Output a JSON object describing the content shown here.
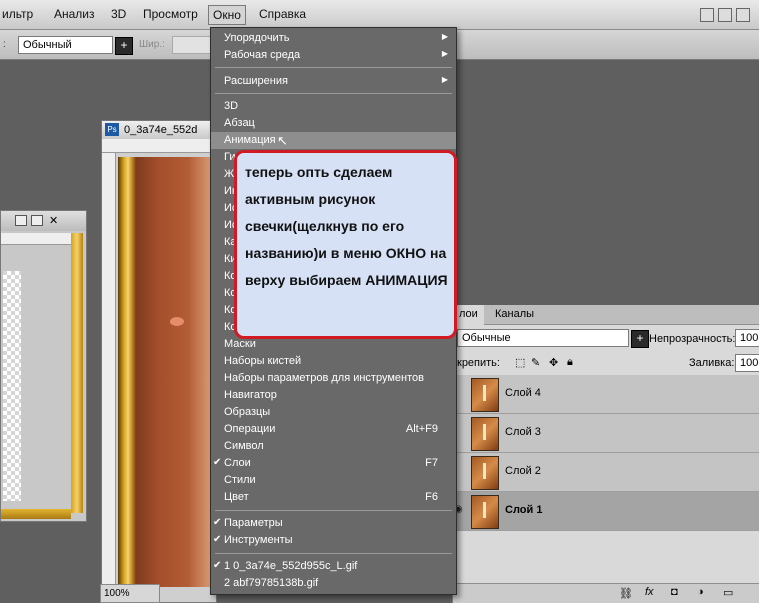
{
  "menubar": {
    "items": [
      "ильтр",
      "Анализ",
      "3D",
      "Просмотр",
      "Окно",
      "Справка"
    ],
    "active": "Окно"
  },
  "options": {
    "mode": "Обычный",
    "width_label": "Шир.:"
  },
  "window_menu": {
    "items": [
      {
        "label": "Упорядочить",
        "submenu": true
      },
      {
        "label": "Рабочая среда",
        "submenu": true
      },
      {
        "label": "Расширения",
        "submenu": true
      },
      {
        "label": "3D"
      },
      {
        "label": "Абзац"
      },
      {
        "label": "Анимация",
        "highlighted": true
      },
      {
        "label": "Ги"
      },
      {
        "label": "Ж"
      },
      {
        "label": "Ин"
      },
      {
        "label": "Ис"
      },
      {
        "label": "Ис"
      },
      {
        "label": "Ка"
      },
      {
        "label": "Ки"
      },
      {
        "label": "Ко"
      },
      {
        "label": "Ко"
      },
      {
        "label": "Ко"
      },
      {
        "label": "Ко"
      },
      {
        "label": "Маски"
      },
      {
        "label": "Наборы кистей"
      },
      {
        "label": "Наборы параметров для инструментов"
      },
      {
        "label": "Навигатор"
      },
      {
        "label": "Образцы"
      },
      {
        "label": "Операции",
        "shortcut": "Alt+F9"
      },
      {
        "label": "Символ"
      },
      {
        "label": "Слои",
        "shortcut": "F7",
        "checked": true
      },
      {
        "label": "Стили"
      },
      {
        "label": "Цвет",
        "shortcut": "F6"
      },
      {
        "label": "Параметры",
        "checked": true
      },
      {
        "label": "Инструменты",
        "checked": true
      },
      {
        "label": "1 0_3a74e_552d955c_L.gif",
        "checked": true
      },
      {
        "label": "2 abf79785138b.gif"
      }
    ]
  },
  "callout": {
    "text": "теперь опть сделаем активным рисунок свечки(щелкнув по его названию)и в меню ОКНО на верху выбираем АНИМАЦИЯ"
  },
  "document": {
    "title": "0_3a74e_552d",
    "zoom": "100%"
  },
  "layers_panel": {
    "tabs": [
      "лои",
      "Каналы"
    ],
    "blend_mode": "Обычные",
    "opacity_label": "Непрозрачность:",
    "opacity_value": "100",
    "lock_label": "крепить:",
    "fill_label": "Заливка:",
    "fill_value": "100",
    "layers": [
      {
        "name": "Слой 4"
      },
      {
        "name": "Слой 3"
      },
      {
        "name": "Слой 2"
      },
      {
        "name": "Слой 1",
        "selected": true
      }
    ]
  },
  "colors": {
    "menu_bg": "#696969",
    "menu_highlight": "#8e8e8e",
    "callout_bg": "#d6e1f6",
    "callout_border": "#d01a24"
  }
}
